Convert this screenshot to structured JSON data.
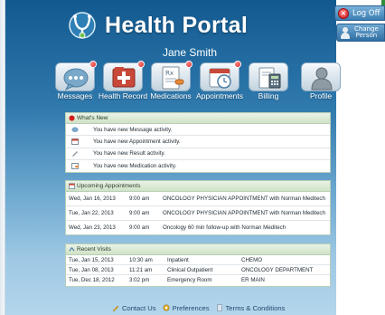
{
  "header": {
    "app_title": "Health Portal",
    "user_name": "Jane Smith",
    "logoff_label": "Log Off",
    "change_person_label": "Change\nPerson"
  },
  "nav": {
    "messages": "Messages",
    "health_record": "Health Record",
    "medications": "Medications",
    "appointments": "Appointments",
    "billing": "Billing",
    "profile": "Profile"
  },
  "whats_new": {
    "title": "What's New",
    "items": [
      {
        "icon": "message-icon",
        "text": "You have new Message activity."
      },
      {
        "icon": "appointment-icon",
        "text": "You have new Appointment activity."
      },
      {
        "icon": "result-icon",
        "text": "You have new Result activity."
      },
      {
        "icon": "medication-icon",
        "text": "You have new Medication activity."
      }
    ]
  },
  "appointments": {
    "title": "Upcoming Appointments",
    "rows": [
      {
        "date": "Wed, Jan 16, 2013",
        "time": "9:00 am",
        "description": "ONCOLOGY PHYSICIAN APPOINTMENT with Norman Meditech"
      },
      {
        "date": "Tue, Jan 22, 2013",
        "time": "9:00 am",
        "description": "ONCOLOGY PHYSICIAN APPOINTMENT with Norman Meditech"
      },
      {
        "date": "Wed, Jan 23, 2013",
        "time": "9:00 am",
        "description": "Oncology 60 min follow-up with Norman Meditech"
      }
    ]
  },
  "visits": {
    "title": "Recent Visits",
    "rows": [
      {
        "date": "Tue, Jan 15, 2013",
        "time": "10:30 am",
        "type": "Inpatient",
        "location": "CHEMO"
      },
      {
        "date": "Tue, Jan 08, 2013",
        "time": "11:21 am",
        "type": "Clinical Outpatient",
        "location": "ONCOLOGY DEPARTMENT"
      },
      {
        "date": "Tue, Dec 18, 2012",
        "time": "3:02 pm",
        "type": "Emergency Room",
        "location": "ER MAIN"
      }
    ]
  },
  "footer": {
    "contact": "Contact Us",
    "preferences": "Preferences",
    "terms": "Terms & Conditions"
  },
  "colors": {
    "header_blue": "#12598f",
    "panel_header_green": "#cfe3c6",
    "badge_red": "#d41a1a"
  }
}
